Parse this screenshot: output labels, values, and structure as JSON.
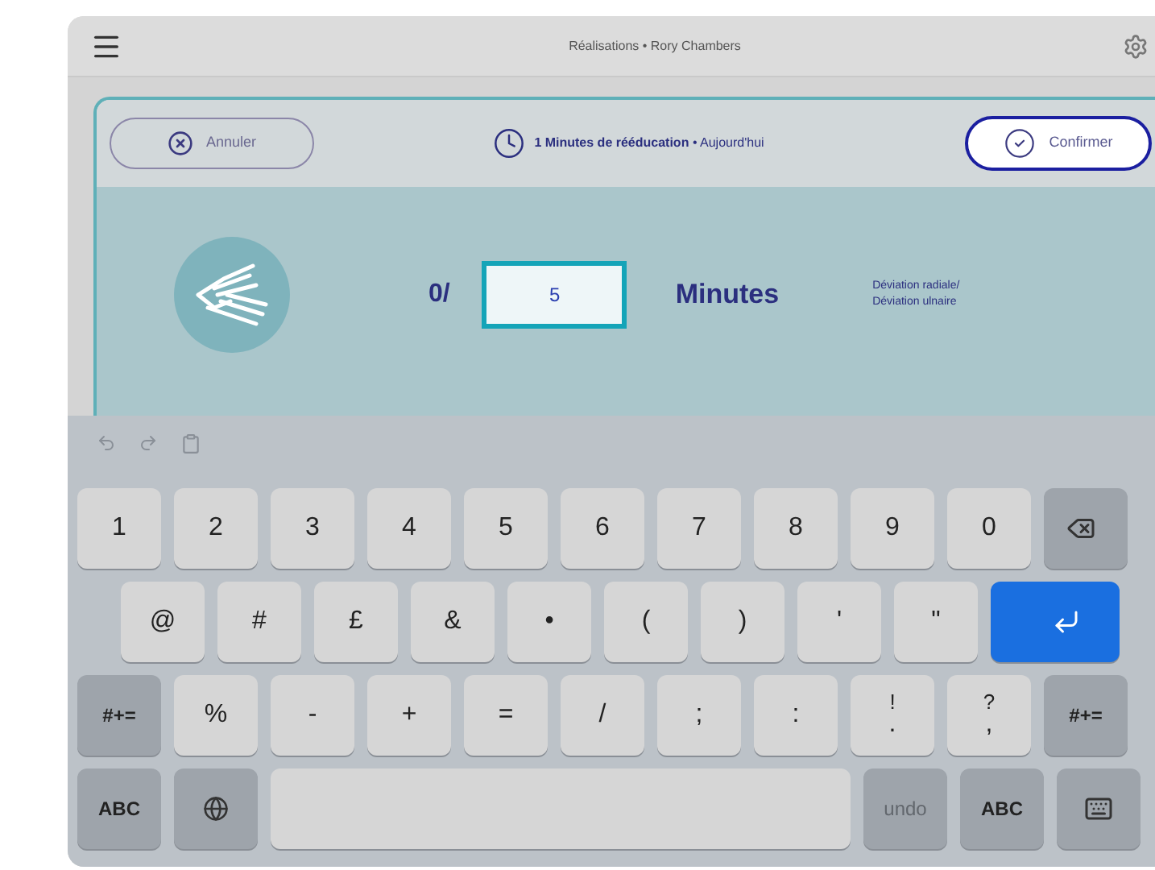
{
  "header": {
    "title": "Réalisations • Rory Chambers"
  },
  "panel": {
    "cancel": "Annuler",
    "summary": "**1 Minutes de rééducation** • Aujourd'hui",
    "confirm": "Confirmer",
    "progress": "0/",
    "input_value": "5",
    "unit": "Minutes",
    "exercise": "Déviation radiale/ Déviation ulnaire"
  },
  "keyboard": {
    "key_rows": [
      {
        "keys": [
          {
            "kind": "char",
            "label": "1"
          },
          {
            "kind": "char",
            "label": "2"
          },
          {
            "kind": "char",
            "label": "3"
          },
          {
            "kind": "char",
            "label": "4"
          },
          {
            "kind": "char",
            "label": "5"
          },
          {
            "kind": "char",
            "label": "6"
          },
          {
            "kind": "char",
            "label": "7"
          },
          {
            "kind": "char",
            "label": "8"
          },
          {
            "kind": "char",
            "label": "9"
          },
          {
            "kind": "char",
            "label": "0"
          },
          {
            "kind": "backspace"
          }
        ]
      },
      {
        "keys": [
          {
            "kind": "indent"
          },
          {
            "kind": "char",
            "label": "@"
          },
          {
            "kind": "char",
            "label": "#"
          },
          {
            "kind": "char",
            "label": "£"
          },
          {
            "kind": "char",
            "label": "&"
          },
          {
            "kind": "char",
            "label": "•"
          },
          {
            "kind": "char",
            "label": "("
          },
          {
            "kind": "char",
            "label": ")"
          },
          {
            "kind": "char",
            "label": "'"
          },
          {
            "kind": "char",
            "label": "\""
          },
          {
            "kind": "return"
          }
        ]
      },
      {
        "keys": [
          {
            "kind": "mod",
            "label": "#+="
          },
          {
            "kind": "char",
            "label": "%"
          },
          {
            "kind": "char",
            "label": "-"
          },
          {
            "kind": "char",
            "label": "+"
          },
          {
            "kind": "char",
            "label": "="
          },
          {
            "kind": "char",
            "label": "/"
          },
          {
            "kind": "char",
            "label": ";"
          },
          {
            "kind": "char",
            "label": ":"
          },
          {
            "kind": "char",
            "label": ".",
            "hint": "!"
          },
          {
            "kind": "char",
            "label": ",",
            "hint": "?"
          },
          {
            "kind": "mod",
            "label": "#+="
          }
        ]
      },
      {
        "keys": [
          {
            "kind": "mod",
            "label": "ABC"
          },
          {
            "kind": "globe"
          },
          {
            "kind": "space"
          },
          {
            "kind": "disabled",
            "label": "undo"
          },
          {
            "kind": "mod",
            "label": "ABC"
          },
          {
            "kind": "dismiss"
          }
        ]
      }
    ]
  }
}
